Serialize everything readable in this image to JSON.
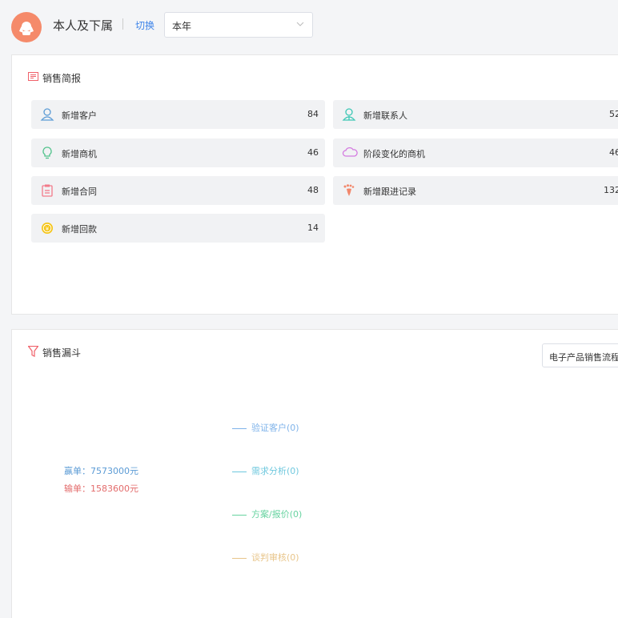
{
  "header": {
    "scope_label": "本人及下属",
    "switch_label": "切换",
    "period_value": "本年"
  },
  "sales_brief": {
    "title": "销售简报",
    "items": [
      {
        "label": "新增客户",
        "value": "84",
        "icon": "customer-icon",
        "color": "#5b9bd5"
      },
      {
        "label": "新增联系人",
        "value": "52",
        "icon": "contact-icon",
        "color": "#3cc7b5"
      },
      {
        "label": "新增商机",
        "value": "46",
        "icon": "lightbulb-icon",
        "color": "#4fc28a"
      },
      {
        "label": "阶段变化的商机",
        "value": "46",
        "icon": "cloud-icon",
        "color": "#d47be0"
      },
      {
        "label": "新增合同",
        "value": "48",
        "icon": "contract-icon",
        "color": "#f27b8a"
      },
      {
        "label": "新增跟进记录",
        "value": "132",
        "icon": "footprint-icon",
        "color": "#f2876b"
      },
      {
        "label": "新增回款",
        "value": "14",
        "icon": "coin-icon",
        "color": "#f5c518"
      }
    ]
  },
  "funnel": {
    "title": "销售漏斗",
    "select_value": "电子产品销售流程",
    "win_text": "赢单：7573000元",
    "lose_text": "输单：1583600元",
    "stages": [
      {
        "label": "验证客户(0)",
        "color": "#7fb3ea"
      },
      {
        "label": "需求分析(0)",
        "color": "#6fc8de"
      },
      {
        "label": "方案/报价(0)",
        "color": "#67d3a0"
      },
      {
        "label": "谈判审核(0)",
        "color": "#e8c58a"
      }
    ]
  }
}
